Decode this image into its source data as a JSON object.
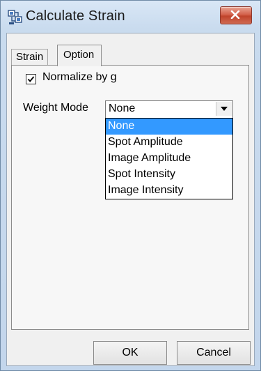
{
  "window": {
    "title": "Calculate Strain",
    "icon": "calculate-strain-app-icon",
    "close_icon": "close-icon",
    "accent_close": "#c94a32"
  },
  "tabs": [
    {
      "label": "Strain",
      "active": false
    },
    {
      "label": "Option",
      "active": true
    }
  ],
  "option_panel": {
    "normalize_checkbox": {
      "label": "Normalize by g",
      "checked": true
    },
    "weight_mode": {
      "label": "Weight Mode",
      "selected": "None",
      "options": [
        "None",
        "Spot Amplitude",
        "Image Amplitude",
        "Spot Intensity",
        "Image Intensity"
      ],
      "highlighted_index": 0,
      "highlight_color": "#3399ff"
    }
  },
  "buttons": {
    "ok": "OK",
    "cancel": "Cancel"
  }
}
